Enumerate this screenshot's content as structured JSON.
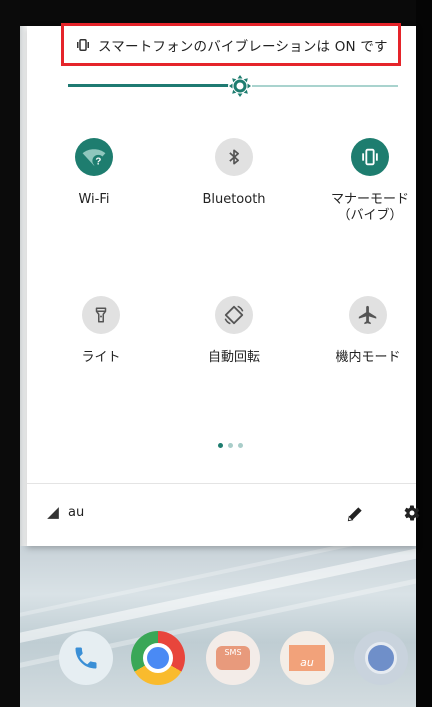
{
  "notification_banner": {
    "text": "スマートフォンのバイブレーションは ON です",
    "icon": "vibrate-icon",
    "highlight_color": "#e5242a"
  },
  "brightness": {
    "level_fraction": 0.52,
    "accent_color": "#1e7d6f",
    "track_color": "#a9d3ce"
  },
  "tiles": [
    {
      "id": "wifi",
      "label": "Wi-Fi",
      "icon": "wifi-unknown-icon",
      "state": "on"
    },
    {
      "id": "bluetooth",
      "label": "Bluetooth",
      "icon": "bluetooth-icon",
      "state": "off"
    },
    {
      "id": "manner",
      "label": "マナーモード\n（バイブ）",
      "icon": "vibrate-icon",
      "state": "on"
    },
    {
      "id": "flashlight",
      "label": "ライト",
      "icon": "flashlight-icon",
      "state": "off"
    },
    {
      "id": "autorotate",
      "label": "自動回転",
      "icon": "auto-rotate-icon",
      "state": "off"
    },
    {
      "id": "airplane",
      "label": "機内モード",
      "icon": "airplane-icon",
      "state": "off"
    }
  ],
  "wifi_badge": "?",
  "page_indicator": {
    "total": 3,
    "active": 0
  },
  "footer": {
    "carrier": "au",
    "signal_icon": "signal-icon",
    "edit_icon": "pencil-icon",
    "settings_icon": "gear-icon"
  },
  "dock": [
    {
      "id": "phone",
      "icon": "phone-icon",
      "color": "#dde8ee"
    },
    {
      "id": "chrome",
      "icon": "chrome-icon",
      "color": "#e8453c"
    },
    {
      "id": "sms",
      "icon": "sms-icon",
      "color": "#e7a98f",
      "label": "SMS"
    },
    {
      "id": "au-mail",
      "icon": "mail-icon",
      "color": "#f1e9e2",
      "label": "au"
    },
    {
      "id": "camera",
      "icon": "camera-icon",
      "color": "#cfd6df"
    }
  ]
}
